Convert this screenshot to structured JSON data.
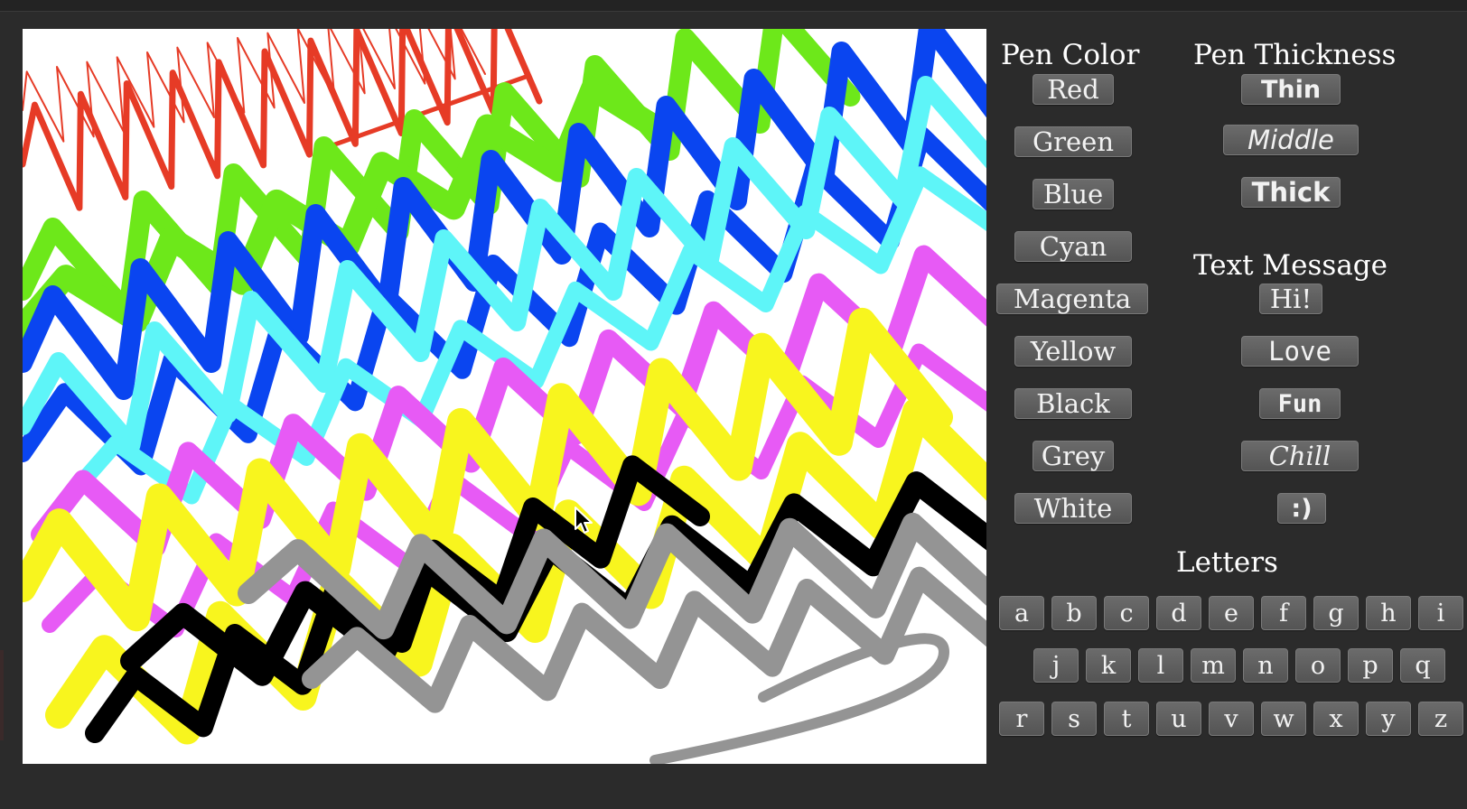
{
  "pen_color": {
    "heading": "Pen Color",
    "buttons": [
      "Red",
      "Green",
      "Blue",
      "Cyan",
      "Magenta",
      "Yellow",
      "Black",
      "Grey",
      "White"
    ]
  },
  "pen_thickness": {
    "heading": "Pen Thickness",
    "buttons": [
      "Thin",
      "Middle",
      "Thick"
    ]
  },
  "text_message": {
    "heading": "Text Message",
    "buttons": [
      "Hi!",
      "Love",
      "Fun",
      "Chill",
      ":)"
    ]
  },
  "letters": {
    "heading": "Letters",
    "row1": [
      "a",
      "b",
      "c",
      "d",
      "e",
      "f",
      "g",
      "h",
      "i"
    ],
    "row2": [
      "j",
      "k",
      "l",
      "m",
      "n",
      "o",
      "p",
      "q"
    ],
    "row3": [
      "r",
      "s",
      "t",
      "u",
      "v",
      "w",
      "x",
      "y",
      "z"
    ]
  },
  "colors": {
    "red": "#e63b26",
    "green": "#6de81a",
    "blue": "#0a45f0",
    "cyan": "#5ef5f8",
    "magenta": "#e75af5",
    "yellow": "#f8f51e",
    "black": "#000000",
    "grey": "#949494",
    "white": "#ffffff",
    "panel_background": "#2b2b2b",
    "button_face": "#5f5f5f"
  },
  "cursor_icon": "arrow-pointer-icon"
}
